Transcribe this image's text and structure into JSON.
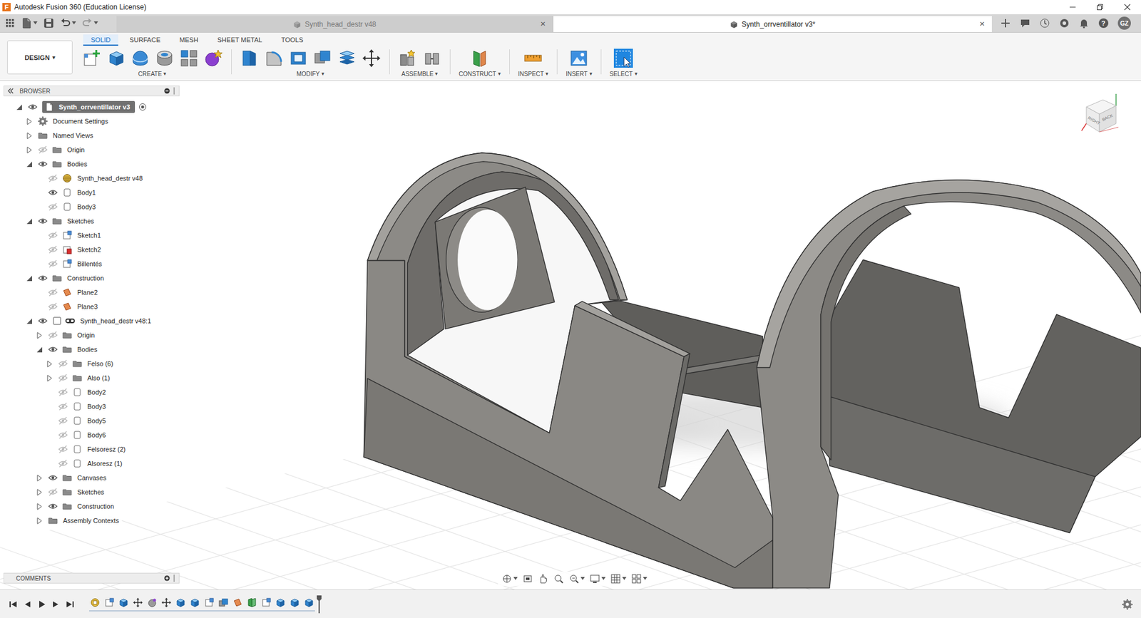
{
  "window": {
    "app_logo": "F",
    "title": "Autodesk Fusion 360 (Education License)"
  },
  "doc_tabs": [
    {
      "label": "Synth_head_destr v48",
      "selected": false,
      "close": "×"
    },
    {
      "label": "Synth_orrventillator v3*",
      "selected": true,
      "close": "×"
    }
  ],
  "header_right": {
    "help": "?",
    "user": "GZ"
  },
  "workspace": {
    "label": "DESIGN",
    "arrow": "▾"
  },
  "ribbon_tabs": [
    {
      "label": "SOLID",
      "selected": true
    },
    {
      "label": "SURFACE",
      "selected": false
    },
    {
      "label": "MESH",
      "selected": false
    },
    {
      "label": "SHEET METAL",
      "selected": false
    },
    {
      "label": "TOOLS",
      "selected": false
    }
  ],
  "tool_groups": [
    {
      "label": "CREATE",
      "arrow": "▾"
    },
    {
      "label": "MODIFY",
      "arrow": "▾"
    },
    {
      "label": "ASSEMBLE",
      "arrow": "▾"
    },
    {
      "label": "CONSTRUCT",
      "arrow": "▾"
    },
    {
      "label": "INSPECT",
      "arrow": "▾"
    },
    {
      "label": "INSERT",
      "arrow": "▾"
    },
    {
      "label": "SELECT",
      "arrow": "▾"
    }
  ],
  "browser": {
    "title": "BROWSER",
    "items": [
      {
        "label": "Synth_orrventillator v3",
        "kind": "root",
        "visibility": "shown",
        "expanded": true,
        "selected": true,
        "children": [
          {
            "label": "Document Settings",
            "kind": "gear",
            "visibility": "none",
            "expanded": false,
            "selected": false
          },
          {
            "label": "Named Views",
            "kind": "folder",
            "visibility": "none",
            "expanded": false,
            "selected": false
          },
          {
            "label": "Origin",
            "kind": "folder",
            "visibility": "hidden",
            "expanded": false,
            "selected": false
          },
          {
            "label": "Bodies",
            "kind": "folder",
            "visibility": "shown",
            "expanded": true,
            "selected": false,
            "children": [
              {
                "label": "Synth_head_destr v48",
                "kind": "mesh",
                "visibility": "hidden",
                "selected": false
              },
              {
                "label": "Body1",
                "kind": "body",
                "visibility": "shown",
                "selected": false
              },
              {
                "label": "Body3",
                "kind": "body",
                "visibility": "hidden",
                "selected": false
              }
            ]
          },
          {
            "label": "Sketches",
            "kind": "folder",
            "visibility": "shown",
            "expanded": true,
            "selected": false,
            "children": [
              {
                "label": "Sketch1",
                "kind": "sketch",
                "visibility": "hidden",
                "selected": false
              },
              {
                "label": "Sketch2",
                "kind": "sketch-warning",
                "visibility": "hidden",
                "selected": false
              },
              {
                "label": "Billentés",
                "kind": "sketch",
                "visibility": "hidden",
                "selected": false
              }
            ]
          },
          {
            "label": "Construction",
            "kind": "folder",
            "visibility": "shown",
            "expanded": true,
            "selected": false,
            "children": [
              {
                "label": "Plane2",
                "kind": "plane",
                "visibility": "hidden",
                "selected": false
              },
              {
                "label": "Plane3",
                "kind": "plane",
                "visibility": "hidden",
                "selected": false
              }
            ]
          },
          {
            "label": "Synth_head_destr v48:1",
            "kind": "linked-component",
            "visibility": "shown",
            "expanded": true,
            "selected": false,
            "children": [
              {
                "label": "Origin",
                "kind": "folder",
                "visibility": "hidden",
                "expanded": false,
                "selected": false
              },
              {
                "label": "Bodies",
                "kind": "folder",
                "visibility": "shown",
                "expanded": true,
                "selected": false,
                "children": [
                  {
                    "label": "Felso (6)",
                    "kind": "folder",
                    "visibility": "hidden",
                    "expanded": false,
                    "selected": false
                  },
                  {
                    "label": "Also (1)",
                    "kind": "folder",
                    "visibility": "hidden",
                    "expanded": false,
                    "selected": false
                  },
                  {
                    "label": "Body2",
                    "kind": "body",
                    "visibility": "hidden",
                    "selected": false
                  },
                  {
                    "label": "Body3",
                    "kind": "body",
                    "visibility": "hidden",
                    "selected": false
                  },
                  {
                    "label": "Body5",
                    "kind": "body",
                    "visibility": "hidden",
                    "selected": false
                  },
                  {
                    "label": "Body6",
                    "kind": "body",
                    "visibility": "hidden",
                    "selected": false
                  },
                  {
                    "label": "Felsoresz (2)",
                    "kind": "body",
                    "visibility": "hidden",
                    "selected": false
                  },
                  {
                    "label": "Alsoresz (1)",
                    "kind": "body",
                    "visibility": "hidden",
                    "selected": false
                  }
                ]
              },
              {
                "label": "Canvases",
                "kind": "folder",
                "visibility": "shown",
                "expanded": false,
                "selected": false
              },
              {
                "label": "Sketches",
                "kind": "folder",
                "visibility": "hidden",
                "expanded": false,
                "selected": false
              },
              {
                "label": "Construction",
                "kind": "folder",
                "visibility": "shown",
                "expanded": false,
                "selected": false
              },
              {
                "label": "Assembly Contexts",
                "kind": "folder",
                "visibility": "none",
                "expanded": false,
                "selected": false
              }
            ]
          }
        ]
      }
    ]
  },
  "comments": {
    "title": "COMMENTS"
  },
  "view_cube": {
    "faces": [
      "RIGHT",
      "BACK"
    ]
  },
  "timeline": {
    "features": [
      {
        "kind": "component"
      },
      {
        "kind": "sketch"
      },
      {
        "kind": "extrude"
      },
      {
        "kind": "move"
      },
      {
        "kind": "form"
      },
      {
        "kind": "move"
      },
      {
        "kind": "extrude"
      },
      {
        "kind": "extrude"
      },
      {
        "kind": "sketch"
      },
      {
        "kind": "combine"
      },
      {
        "kind": "plane"
      },
      {
        "kind": "construct"
      },
      {
        "kind": "sketch"
      },
      {
        "kind": "extrude"
      },
      {
        "kind": "extrude"
      },
      {
        "kind": "extrude"
      }
    ]
  }
}
